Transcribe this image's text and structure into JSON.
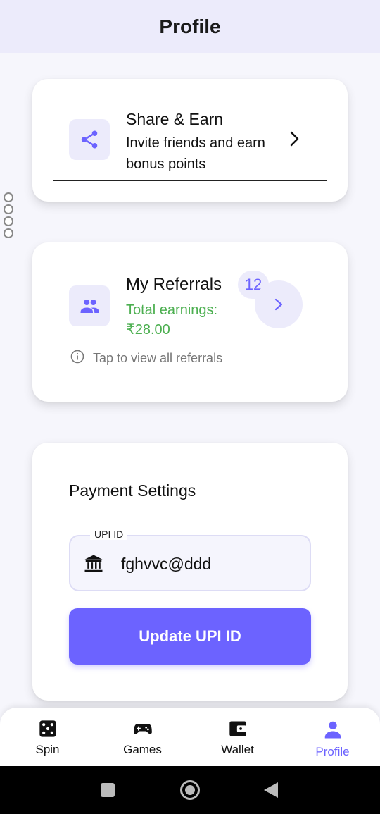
{
  "app_bar": {
    "title": "Profile"
  },
  "share_card": {
    "icon": "share-icon",
    "title": "Share & Earn",
    "subtitle": "Invite friends and earn bonus points",
    "chevron": "chevron-right-icon"
  },
  "referrals_card": {
    "icon": "people-icon",
    "title": "My Referrals",
    "count": "12",
    "earnings_label": "Total earnings:",
    "earnings_value": "₹28.00",
    "hint": "Tap to view all referrals",
    "hint_icon": "info-icon"
  },
  "payment_card": {
    "title": "Payment Settings",
    "upi_label": "UPI ID",
    "upi_value": "fghvvc@ddd",
    "upi_icon": "bank-icon",
    "button_label": "Update UPI ID"
  },
  "bottom_nav": {
    "items": [
      {
        "label": "Spin",
        "icon": "dice-icon",
        "active": false
      },
      {
        "label": "Games",
        "icon": "gamepad-icon",
        "active": false
      },
      {
        "label": "Wallet",
        "icon": "wallet-icon",
        "active": false
      },
      {
        "label": "Profile",
        "icon": "person-icon",
        "active": true
      }
    ]
  },
  "colors": {
    "accent": "#6c63ff",
    "accent_soft": "#ecebfb",
    "earnings_green": "#4caf50",
    "background": "#f6f6fc"
  }
}
